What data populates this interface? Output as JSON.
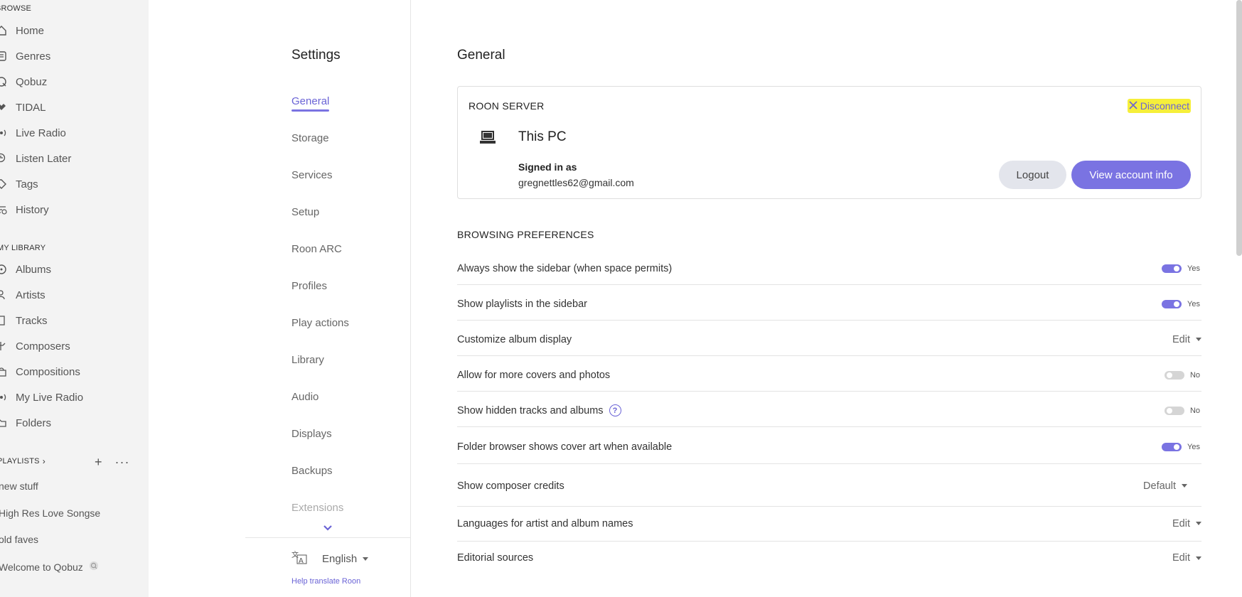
{
  "sidebar": {
    "browse_heading": "BROWSE",
    "browse_items": [
      {
        "label": "Home",
        "icon": "home-icon"
      },
      {
        "label": "Genres",
        "icon": "genres-icon"
      },
      {
        "label": "Qobuz",
        "icon": "qobuz-icon"
      },
      {
        "label": "TIDAL",
        "icon": "tidal-icon"
      },
      {
        "label": "Live Radio",
        "icon": "radio-icon"
      },
      {
        "label": "Listen Later",
        "icon": "listen-later-icon"
      },
      {
        "label": "Tags",
        "icon": "tag-icon"
      },
      {
        "label": "History",
        "icon": "history-icon"
      }
    ],
    "library_heading": "MY LIBRARY",
    "library_items": [
      {
        "label": "Albums",
        "icon": "album-icon"
      },
      {
        "label": "Artists",
        "icon": "artist-icon"
      },
      {
        "label": "Tracks",
        "icon": "track-icon"
      },
      {
        "label": "Composers",
        "icon": "composer-icon"
      },
      {
        "label": "Compositions",
        "icon": "composition-icon"
      },
      {
        "label": "My Live Radio",
        "icon": "radio-icon"
      },
      {
        "label": "Folders",
        "icon": "folder-icon"
      }
    ],
    "playlists_heading": "PLAYLISTS",
    "playlists": [
      {
        "label": "new stuff"
      },
      {
        "label": "High Res Love Songse"
      },
      {
        "label": "old faves"
      },
      {
        "label": "Welcome to Qobuz"
      }
    ]
  },
  "settings": {
    "title": "Settings",
    "items": [
      {
        "label": "General"
      },
      {
        "label": "Storage"
      },
      {
        "label": "Services"
      },
      {
        "label": "Setup"
      },
      {
        "label": "Roon ARC"
      },
      {
        "label": "Profiles"
      },
      {
        "label": "Play actions"
      },
      {
        "label": "Library"
      },
      {
        "label": "Audio"
      },
      {
        "label": "Displays"
      },
      {
        "label": "Backups"
      },
      {
        "label": "Extensions"
      }
    ],
    "active_index": 0,
    "language": "English",
    "help_translate": "Help translate Roon"
  },
  "main": {
    "title": "General",
    "server": {
      "label": "ROON SERVER",
      "disconnect": "Disconnect",
      "name": "This PC",
      "signed_in_label": "Signed in as",
      "email": "gregnettles62@gmail.com",
      "logout": "Logout",
      "view_account": "View account info"
    },
    "browsing_heading": "BROWSING PREFERENCES",
    "prefs": [
      {
        "label": "Always show the sidebar (when space permits)",
        "kind": "toggle",
        "on": true,
        "value": "Yes"
      },
      {
        "label": "Show playlists in the sidebar",
        "kind": "toggle",
        "on": true,
        "value": "Yes"
      },
      {
        "label": "Customize album display",
        "kind": "dropdown",
        "value": "Edit"
      },
      {
        "label": "Allow for more covers and photos",
        "kind": "toggle",
        "on": false,
        "value": "No"
      },
      {
        "label": "Show hidden tracks and albums",
        "kind": "toggle",
        "on": false,
        "value": "No",
        "help": "?"
      },
      {
        "label": "Folder browser shows cover art when available",
        "kind": "toggle",
        "on": true,
        "value": "Yes"
      },
      {
        "label": "Show composer credits",
        "kind": "dropdown",
        "value": "Default"
      },
      {
        "label": "Languages for artist and album names",
        "kind": "dropdown",
        "value": "Edit"
      },
      {
        "label": "Editorial sources",
        "kind": "dropdown",
        "value": "Edit"
      }
    ]
  },
  "colors": {
    "accent": "#7a73e2",
    "highlight": "#f6ef3a",
    "sidebar_bg": "#f3f3f3"
  }
}
